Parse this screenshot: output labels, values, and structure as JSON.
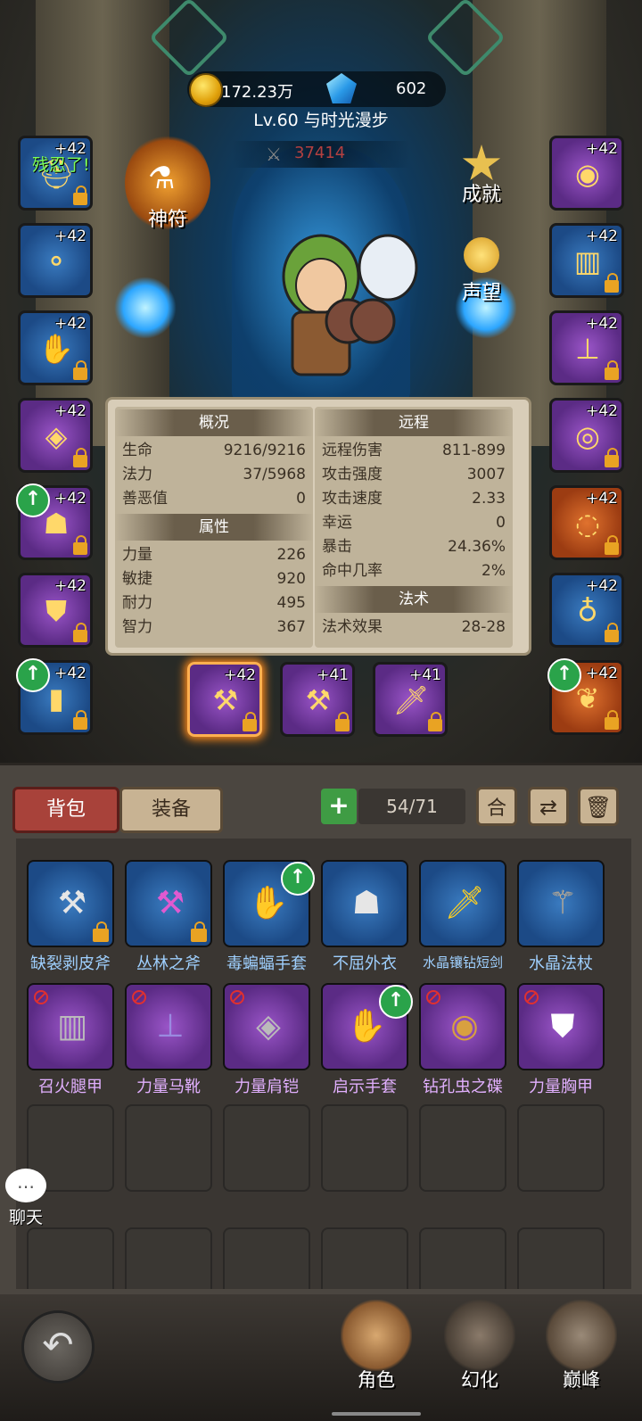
{
  "header": {
    "gold": "172.23万",
    "diamonds": "602",
    "title": "Lv.60 与时光漫步",
    "combat_power": "37414",
    "chat_bubble": "残忍了!"
  },
  "side_buttons": {
    "rune": "神符",
    "achievement": "成就",
    "reputation": "声望"
  },
  "left_slots": [
    "+42",
    "+42",
    "+42",
    "+42",
    "+42",
    "+42",
    "+42"
  ],
  "right_slots": [
    "+42",
    "+42",
    "+42",
    "+42",
    "+42",
    "+42",
    "+42"
  ],
  "weapon_slots": [
    "+42",
    "+41",
    "+41"
  ],
  "stats": {
    "overview": {
      "header": "概况",
      "rows": [
        {
          "label": "生命",
          "value": "9216/9216"
        },
        {
          "label": "法力",
          "value": "37/5968"
        },
        {
          "label": "善恶值",
          "value": "0"
        }
      ]
    },
    "attributes": {
      "header": "属性",
      "rows": [
        {
          "label": "力量",
          "value": "226"
        },
        {
          "label": "敏捷",
          "value": "920"
        },
        {
          "label": "耐力",
          "value": "495"
        },
        {
          "label": "智力",
          "value": "367"
        }
      ]
    },
    "ranged": {
      "header": "远程",
      "rows": [
        {
          "label": "远程伤害",
          "value": "811-899"
        },
        {
          "label": "攻击强度",
          "value": "3007"
        },
        {
          "label": "攻击速度",
          "value": "2.33"
        },
        {
          "label": "幸运",
          "value": "0"
        },
        {
          "label": "暴击",
          "value": "24.36%"
        },
        {
          "label": "命中几率",
          "value": "2%"
        }
      ]
    },
    "spell": {
      "header": "法术",
      "rows": [
        {
          "label": "法术效果",
          "value": "28-28"
        }
      ]
    }
  },
  "bag": {
    "tab_bag": "背包",
    "tab_equip": "装备",
    "add": "+",
    "capacity": "54/71",
    "merge": "合",
    "items_row1": [
      "缺裂剥皮斧",
      "丛林之斧",
      "毒蝙蝠手套",
      "不屈外衣",
      "水晶镶钻短剑",
      "水晶法杖"
    ],
    "items_row2": [
      "召火腿甲",
      "力量马靴",
      "力量肩铠",
      "启示手套",
      "钻孔虫之碟",
      "力量胸甲"
    ]
  },
  "chat": "聊天",
  "nav": {
    "role": "角色",
    "transform": "幻化",
    "peak": "巅峰"
  },
  "colors": {
    "rare_blue": "#1c4a86",
    "epic_purple": "#5b2b85",
    "legend_orange": "#9c3c12",
    "upgrade_green": "#2aa34a"
  }
}
